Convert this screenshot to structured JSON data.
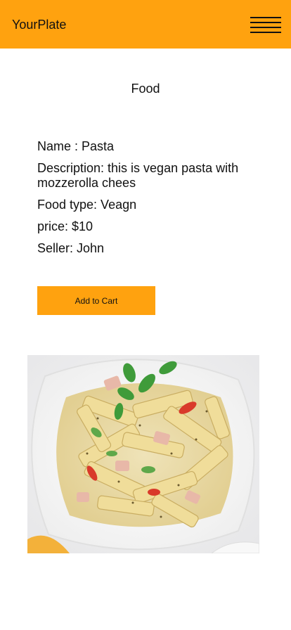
{
  "header": {
    "brand": "YourPlate",
    "menu_icon": "hamburger-menu-icon",
    "background_color": "#ffa20f"
  },
  "page": {
    "title": "Food"
  },
  "food": {
    "name_line": "Name : Pasta",
    "description_line": "Description: this is vegan pasta with mozzerolla chees",
    "type_line": "Food type: Veagn",
    "price_line": "price: $10",
    "seller_line": "Seller: John"
  },
  "actions": {
    "add_to_cart_label": "Add to Cart",
    "button_color": "#ffa20f"
  },
  "image": {
    "subject": "penne-pasta-dish-photo"
  }
}
